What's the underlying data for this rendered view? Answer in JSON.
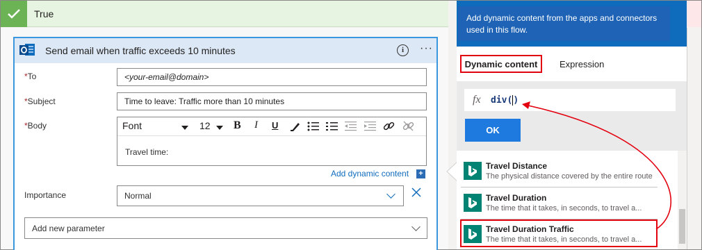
{
  "condition": {
    "label": "True"
  },
  "card": {
    "title": "Send email when traffic exceeds 10 minutes",
    "info_symbol": "i",
    "more_symbol": "···",
    "to": {
      "label": "To",
      "value": "<your-email@domain>"
    },
    "subject": {
      "label": "Subject",
      "value": "Time to leave: Traffic more than 10 minutes"
    },
    "body": {
      "label": "Body",
      "font_select": "Font",
      "font_size": "12",
      "bold": "B",
      "italic": "I",
      "underline": "U",
      "content": "Travel time:"
    },
    "add_dynamic_content": "Add dynamic content",
    "importance": {
      "label": "Importance",
      "value": "Normal"
    },
    "add_parameter": "Add new parameter",
    "required_marker": "*"
  },
  "panel": {
    "header_text": "Add dynamic content from the apps and connectors used in this flow.",
    "tabs": [
      {
        "label": "Dynamic content",
        "selected": true
      },
      {
        "label": "Expression",
        "selected": false
      }
    ],
    "expression": {
      "fx": "fx",
      "value": "div(",
      "closing": ")"
    },
    "ok_label": "OK",
    "items": [
      {
        "title": "Travel Distance",
        "description": "The physical distance covered by the entire route"
      },
      {
        "title": "Travel Duration",
        "description": "The time that it takes, in seconds, to travel a..."
      },
      {
        "title": "Travel Duration Traffic",
        "description": "The time that it takes, in seconds, to travel a..."
      }
    ]
  },
  "colors": {
    "accent": "#0f6cbd",
    "highlight": "#e3000f",
    "success": "#6bb354",
    "bing": "#008373"
  }
}
